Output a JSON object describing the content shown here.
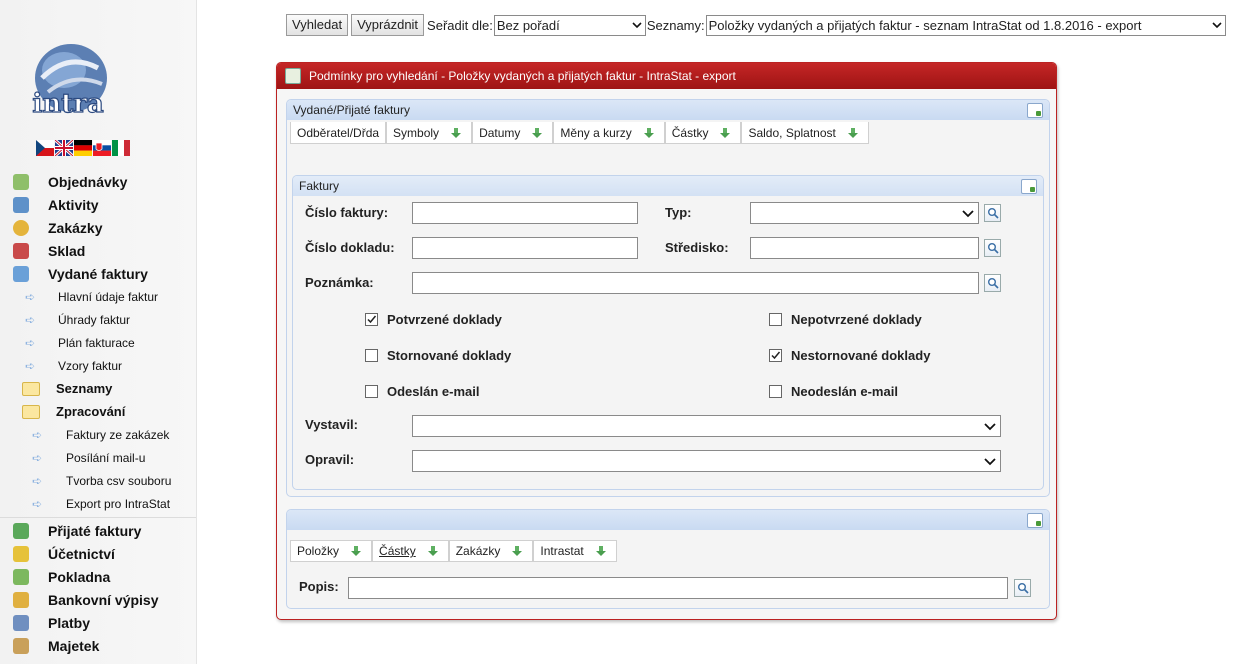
{
  "toolbar": {
    "search_button": "Vyhledat",
    "clear_button": "Vyprázdnit",
    "sort_label": "Seřadit dle:",
    "sort_value": "Bez pořadí",
    "lists_label": "Seznamy:",
    "lists_value": "Položky vydaných a přijatých faktur - seznam IntraStat od 1.8.2016 - export"
  },
  "sidebar": {
    "logo_text": "intra",
    "flags": [
      "cz",
      "gb",
      "de",
      "sk",
      "it"
    ],
    "items": [
      {
        "label": "Objednávky",
        "type": "main",
        "icon": "orders-icon",
        "color": "#8fbf6a"
      },
      {
        "label": "Aktivity",
        "type": "main",
        "icon": "activities-icon",
        "color": "#5e91c9"
      },
      {
        "label": "Zakázky",
        "type": "main",
        "icon": "contracts-icon",
        "color": "#e4b43c"
      },
      {
        "label": "Sklad",
        "type": "main",
        "icon": "warehouse-icon",
        "color": "#c94a4a"
      },
      {
        "label": "Vydané faktury",
        "type": "main",
        "icon": "issued-invoices-icon",
        "color": "#6aa0d8"
      },
      {
        "label": "Hlavní údaje faktur",
        "type": "sub"
      },
      {
        "label": "Úhrady faktur",
        "type": "sub"
      },
      {
        "label": "Plán fakturace",
        "type": "sub"
      },
      {
        "label": "Vzory faktur",
        "type": "sub"
      },
      {
        "label": "Seznamy",
        "type": "folder"
      },
      {
        "label": "Zpracování",
        "type": "folder"
      },
      {
        "label": "Faktury ze zakázek",
        "type": "sub2"
      },
      {
        "label": "Posílání mail-u",
        "type": "sub2"
      },
      {
        "label": "Tvorba csv souboru",
        "type": "sub2"
      },
      {
        "label": "Export pro IntraStat",
        "type": "sub2"
      },
      {
        "label": "Přijaté faktury",
        "type": "main",
        "icon": "received-invoices-icon",
        "color": "#5aa85a"
      },
      {
        "label": "Účetnictví",
        "type": "main",
        "icon": "accounting-icon",
        "color": "#e6c23a"
      },
      {
        "label": "Pokladna",
        "type": "main",
        "icon": "cash-icon",
        "color": "#7cb85e"
      },
      {
        "label": "Bankovní výpisy",
        "type": "main",
        "icon": "bank-icon",
        "color": "#e0b040"
      },
      {
        "label": "Platby",
        "type": "main",
        "icon": "payments-icon",
        "color": "#6f8fc0"
      },
      {
        "label": "Majetek",
        "type": "main",
        "icon": "property-icon",
        "color": "#c9a05a"
      }
    ]
  },
  "panel": {
    "title": "Podmínky pro vyhledání - Položky vydaných a přijatých faktur - IntraStat - export",
    "section1": {
      "title": "Vydané/Přijaté faktury",
      "tabs": [
        "Odběratel/Dřda",
        "Symboly",
        "Datumy",
        "Měny a kurzy",
        "Částky",
        "Saldo, Splatnost"
      ]
    },
    "faktury": {
      "title": "Faktury",
      "invoice_number_label": "Číslo faktury:",
      "type_label": "Typ:",
      "document_number_label": "Číslo dokladu:",
      "center_label": "Středisko:",
      "note_label": "Poznámka:",
      "checkboxes": [
        {
          "label": "Potvrzené doklady",
          "checked": true
        },
        {
          "label": "Nepotvrzené doklady",
          "checked": false
        },
        {
          "label": "Stornované doklady",
          "checked": false
        },
        {
          "label": "Nestornované doklady",
          "checked": true
        },
        {
          "label": "Odeslán e-mail",
          "checked": false
        },
        {
          "label": "Neodeslán e-mail",
          "checked": false
        }
      ],
      "issued_by_label": "Vystavil:",
      "edited_by_label": "Opravil:"
    },
    "section2": {
      "tabs": [
        "Položky",
        "Částky",
        "Zakázky",
        "Intrastat"
      ],
      "description_label": "Popis:"
    }
  }
}
